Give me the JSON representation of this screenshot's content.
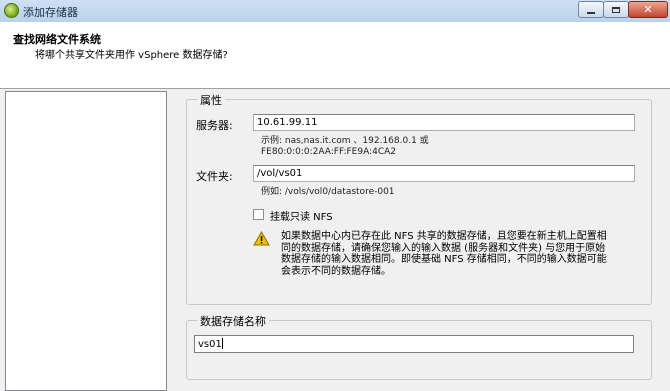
{
  "window": {
    "title": "添加存储器",
    "icon": "vsphere-app-icon",
    "controls": [
      "minimize-icon",
      "maximize-icon",
      "close-icon"
    ]
  },
  "header": {
    "title": "查找网络文件系统",
    "subtitle": "将哪个共享文件夹用作 vSphere 数据存储?"
  },
  "properties": {
    "group_label": "属性",
    "server": {
      "label": "服务器:",
      "value": "10.61.99.11",
      "hint_line1": "示例: nas,nas.it.com 、192.168.0.1 或",
      "hint_line2": "FE80:0:0:0:2AA:FF:FE9A:4CA2"
    },
    "folder": {
      "label": "文件夹:",
      "value": "/vol/vs01",
      "hint": "例如: /vols/vol0/datastore-001"
    },
    "readonly": {
      "label": "挂载只读 NFS",
      "checked": false
    },
    "warning": {
      "icon": "warning-icon",
      "line1": "如果数据中心内已存在此 NFS 共享的数据存储，且您要在新主机上配置相",
      "line2": "同的数据存储，请确保您输入的输入数据 (服务器和文件夹) 与您用于原始",
      "line3": "数据存储的输入数据相同。即使基础 NFS 存储相同，不同的输入数据可能",
      "line4": "会表示不同的数据存储。"
    }
  },
  "datastore": {
    "group_label": "数据存储名称",
    "value": "vs01"
  },
  "colors": {
    "titlebar": "#b9d1ea",
    "close_button": "#c2452d",
    "window_bg": "#f0f0f0",
    "warning_yellow": "#f2c200"
  }
}
